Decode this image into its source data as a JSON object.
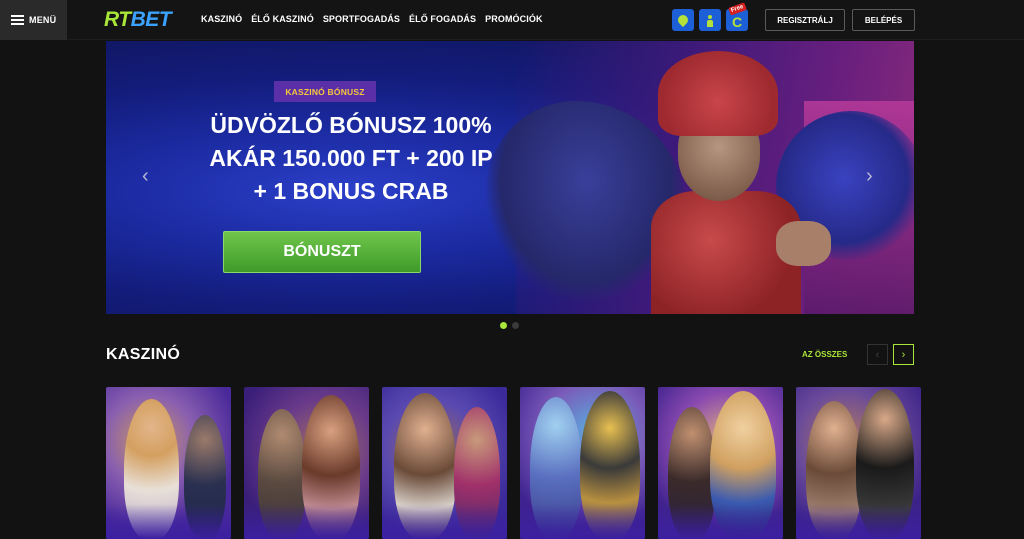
{
  "header": {
    "menu_label": "MENÜ",
    "logo": {
      "part1": "RT",
      "part2": "BET"
    },
    "nav": [
      "KASZINÓ",
      "ÉLŐ KASZINÓ",
      "SPORTFOGADÁS",
      "ÉLŐ FOGADÁS",
      "PROMÓCIÓK"
    ],
    "icons": [
      "location-icon",
      "person-icon",
      "free-cashback-icon"
    ],
    "free_badge": "Free",
    "register_label": "REGISZTRÁLJ",
    "login_label": "BELÉPÉS",
    "colors": {
      "accent_green": "#a8e63a",
      "accent_blue": "#3ba3ff",
      "badge_purple": "#5a2fa8"
    }
  },
  "hero": {
    "badge": "KASZINÓ BÓNUSZ",
    "line1": "ÜDVÖZLŐ BÓNUSZ 100%",
    "line2": "AKÁR 150.000 FT + 200 IP",
    "line3": "+ 1 BONUS CRAB",
    "cta_label": "BÓNUSZT",
    "prev_arrow": "‹",
    "next_arrow": "›",
    "slides_total": 2,
    "active_slide": 1
  },
  "casino": {
    "title": "KASZINÓ",
    "see_all": "AZ ÖSSZES",
    "games": [
      {
        "name": "game-tile-1"
      },
      {
        "name": "game-tile-2"
      },
      {
        "name": "game-tile-3"
      },
      {
        "name": "game-tile-4"
      },
      {
        "name": "game-tile-5"
      },
      {
        "name": "game-tile-6"
      }
    ]
  }
}
